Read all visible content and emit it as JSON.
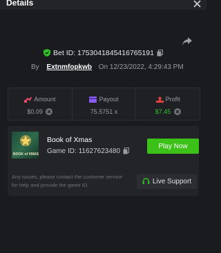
{
  "header": {
    "title": "Details"
  },
  "bet": {
    "id_text": "Bet ID: 1753041845416765191"
  },
  "byline": {
    "by": "By",
    "user": "Extnmfopkwb",
    "on": "On",
    "datetime": "12/23/2022, 4:29:43 PM"
  },
  "stats": {
    "amount": {
      "label": "Amount",
      "value": "$0.09"
    },
    "payout": {
      "label": "Payout",
      "value": "75.5751 x"
    },
    "profit": {
      "label": "Profit",
      "value": "$7.45"
    }
  },
  "game": {
    "name": "Book of Xmas",
    "id_text": "Game ID: 11627623480",
    "thumb_text": "BOOK of XMAS",
    "play_label": "Play Now",
    "help_text": "Any issues, please contact the customer service for help and provide the game ID.",
    "support_label": "Live Support"
  },
  "colors": {
    "accent_green": "#3bc117",
    "profit_green": "#30c52e",
    "background": "#1a1b1f"
  },
  "icons": [
    "close-icon",
    "share-icon",
    "shield-icon",
    "copy-icon",
    "amount-icon",
    "payout-icon",
    "profit-icon",
    "coin-icon",
    "headset-icon"
  ]
}
